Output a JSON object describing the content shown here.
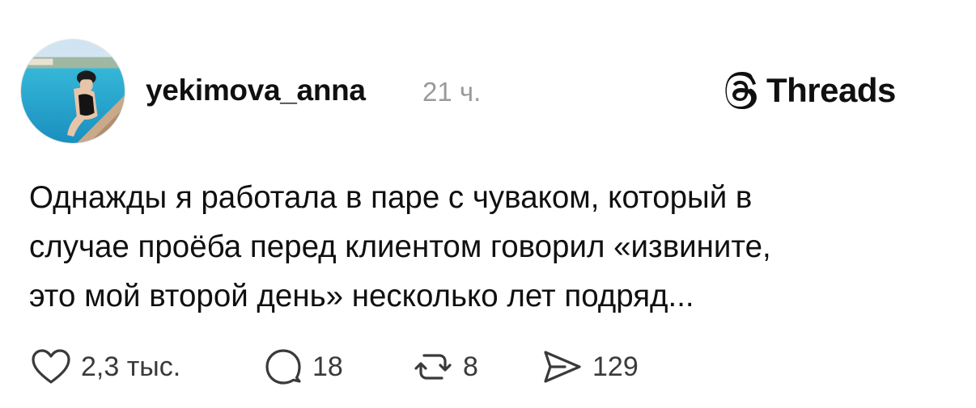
{
  "post": {
    "username": "yekimova_anna",
    "timestamp": "21 ч.",
    "text": "Однажды я работала в паре с чуваком, который в\nслучае проёба перед клиентом говорил «извините,\nэто мой второй день» несколько лет подряд...",
    "avatar_icon": "profile-photo-pool",
    "likes": "2,3 тыс.",
    "replies": "18",
    "reposts": "8",
    "shares": "129"
  },
  "brand": {
    "name": "Threads",
    "icon": "threads-logo-icon"
  },
  "colors": {
    "text": "#101010",
    "muted": "#9a9a9a",
    "icon": "#3a3a3a",
    "background": "#ffffff"
  }
}
